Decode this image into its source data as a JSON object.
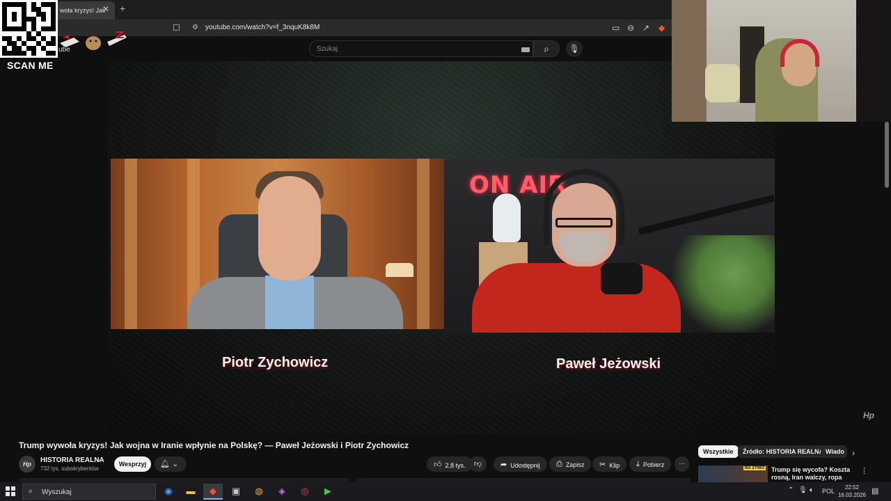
{
  "browser": {
    "tab_title": "woła kryzys! Jak",
    "tab_close": "✕",
    "new_tab": "+",
    "url": "youtube.com/watch?v=f_3nquK8k8M"
  },
  "overlay": {
    "scan_label": "SCAN ME",
    "sticker_text": "ube"
  },
  "youtube": {
    "search_placeholder": "Szukaj",
    "video_title": "Trump wywoła kryzys! Jak wojna w Iranie wpłynie na Polskę? — Paweł Jeżowski i Piotr Zychowicz",
    "channel": {
      "name": "HISTORIA REALNA",
      "subscribers": "732 tys. subskrybentów",
      "avatar_text": "Hp"
    },
    "support_label": "Wesprzyj",
    "actions": {
      "likes": "2,8 tys.",
      "share": "Udostępnij",
      "save": "Zapisz",
      "clip": "Klip",
      "download": "Pobierz",
      "more": "···"
    },
    "chips": [
      "Wszystkie",
      "Źródło: HISTORIA REALNA",
      "Wiado"
    ],
    "recommendation": {
      "title": "Trump się wycofa? Koszta rosną, Iran walczy, ropa drożej...",
      "badge": "NA ŻYWO"
    }
  },
  "video": {
    "guest_left": "Piotr Zychowicz",
    "guest_right": "Paweł Jeżowski",
    "neon": "ON AIR",
    "watermark": "Hp"
  },
  "taskbar": {
    "search_label": "Wyszukaj",
    "language": "POL",
    "time": "22:52",
    "date": "16.03.2026"
  },
  "colors": {
    "background": "#0f0f0f",
    "chip_selected": "#f1f1f1",
    "name_shadow": "#8a0d15",
    "neon": "#ff5d6b"
  }
}
